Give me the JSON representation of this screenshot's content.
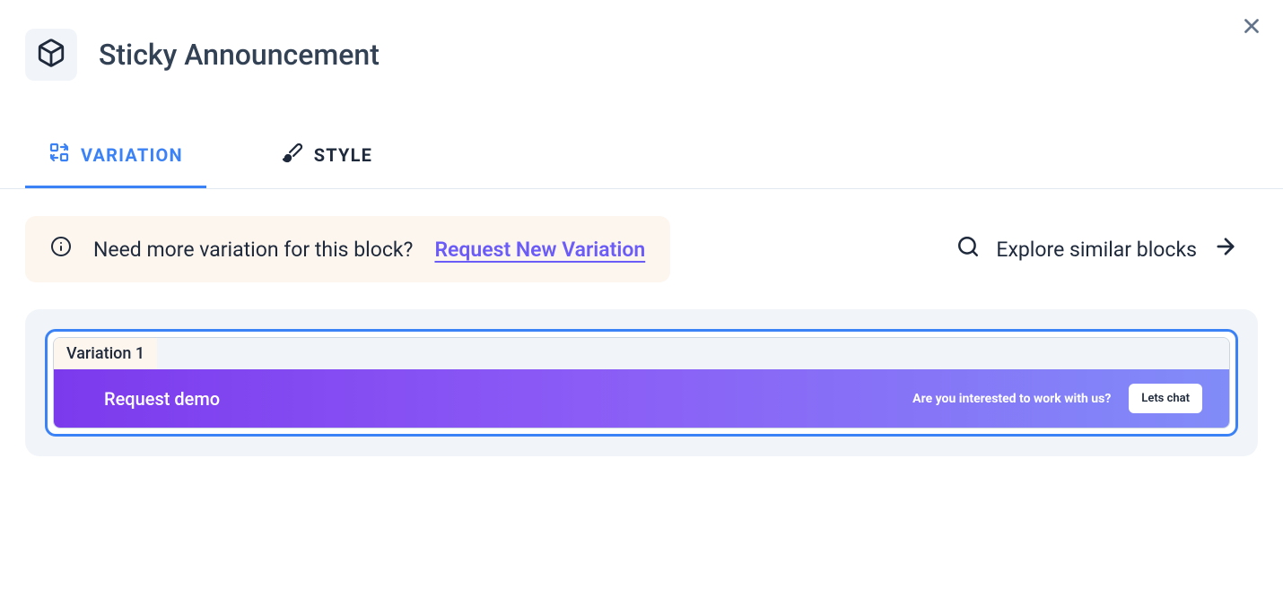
{
  "header": {
    "title": "Sticky Announcement"
  },
  "tabs": [
    {
      "label": "VARIATION",
      "active": true
    },
    {
      "label": "STYLE",
      "active": false
    }
  ],
  "notice": {
    "text": "Need more variation for this block?",
    "link_label": "Request New Variation"
  },
  "explore": {
    "label": "Explore similar blocks"
  },
  "variation": {
    "badge": "Variation 1",
    "announcement": {
      "left_text": "Request demo",
      "question": "Are you interested to work with us?",
      "button_label": "Lets chat"
    }
  },
  "colors": {
    "accent": "#3b82f6",
    "link": "#6b5cf7",
    "notice_bg": "#fdf6ee",
    "gradient_start": "#7c3aed",
    "gradient_end": "#818cf8"
  }
}
